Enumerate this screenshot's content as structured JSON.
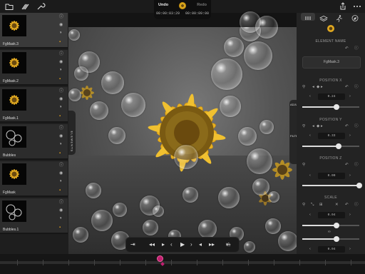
{
  "toolbar": {
    "undo_label": "Undo",
    "redo_label": "Redo",
    "timecode_current": "00:00:03:29",
    "timecode_total": "00:00:09:00"
  },
  "layers": [
    {
      "name": "FgMask.3",
      "thumb": "sunflower",
      "selected": true
    },
    {
      "name": "FgMask.2",
      "thumb": "sunflower",
      "selected": false
    },
    {
      "name": "FgMask.1",
      "thumb": "sunflower",
      "selected": false
    },
    {
      "name": "Bubbles",
      "thumb": "bubbles",
      "selected": false
    },
    {
      "name": "FgMask",
      "thumb": "sunflower",
      "selected": false
    },
    {
      "name": "Bubbles.1",
      "thumb": "bubbles",
      "selected": false
    }
  ],
  "drawers": {
    "left": "ELEMENTS",
    "right_top": "ADJUST",
    "right_bottom": "FILTER"
  },
  "inspector": {
    "element_name_heading": "ELEMENT NAME",
    "element_name_value": "FgMask.3",
    "position_x_heading": "POSITION X",
    "position_x_value": "0.24",
    "position_x_level": 0.6,
    "position_y_heading": "POSITION Y",
    "position_y_value": "0.33",
    "position_y_level": 0.64,
    "position_z_heading": "POSITION Z",
    "position_z_value": "0.00",
    "position_z_level": 1.0,
    "scale_heading": "SCALE",
    "scale_x_value": "0.04",
    "scale_x_level": 0.6,
    "scale_y_value": "0.04",
    "scale_y_level": 0.6
  },
  "colors": {
    "accent": "#e0a020",
    "playhead": "#c02070",
    "panel": "#232323"
  },
  "playback": {
    "position": 0.44
  }
}
